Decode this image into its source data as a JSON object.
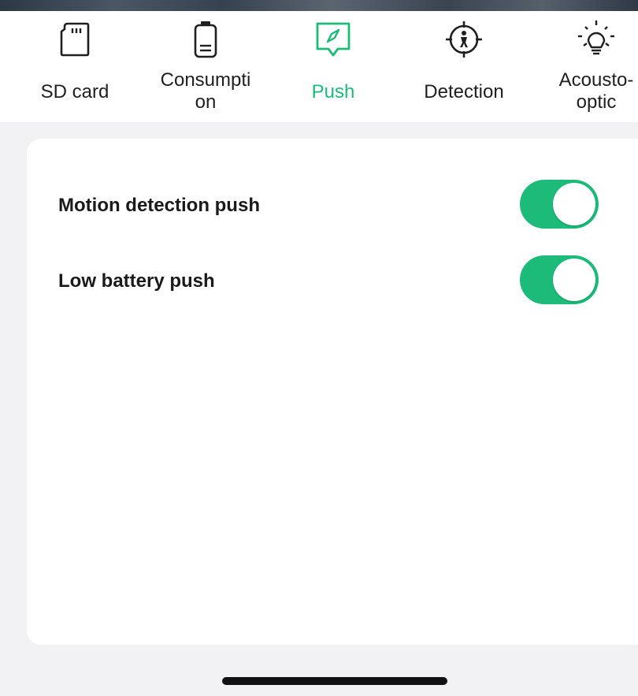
{
  "colors": {
    "accent": "#1dbb79",
    "background": "#f2f2f4",
    "card": "#ffffff",
    "text": "#1a1a1a"
  },
  "tabs": [
    {
      "label": "SD card",
      "icon": "sd-card-icon",
      "active": false
    },
    {
      "label": "Consumpti\non",
      "icon": "battery-icon",
      "active": false
    },
    {
      "label": "Push",
      "icon": "push-message-icon",
      "active": true
    },
    {
      "label": "Detection",
      "icon": "detection-icon",
      "active": false
    },
    {
      "label": "Acousto-\noptic",
      "icon": "light-bulb-icon",
      "active": false
    }
  ],
  "settings": [
    {
      "label": "Motion detection push",
      "enabled": true
    },
    {
      "label": "Low battery push",
      "enabled": true
    }
  ]
}
